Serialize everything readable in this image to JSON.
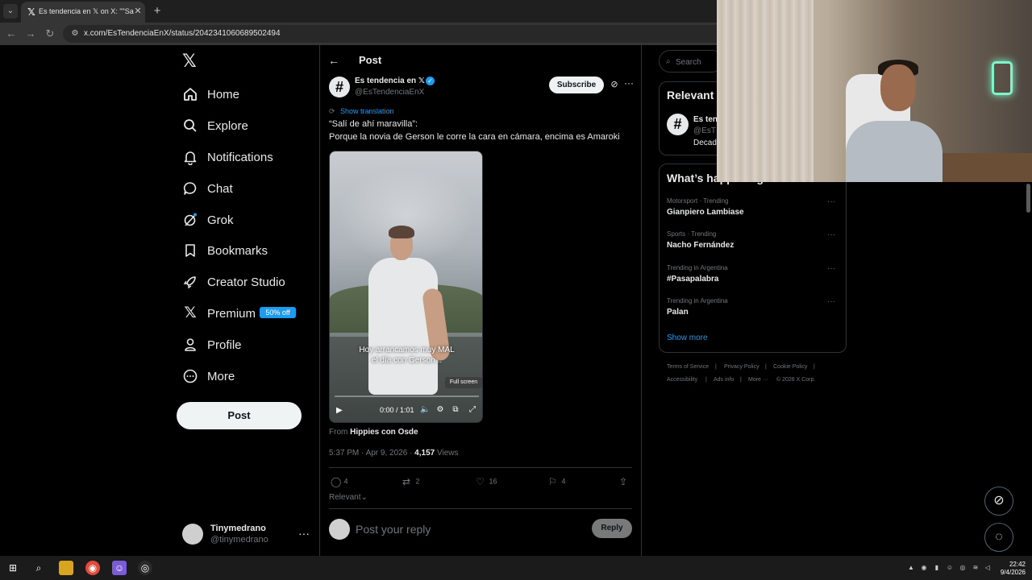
{
  "browser": {
    "tab_title": "Es tendencia en 𝕏 on X: \"\"Salí d",
    "url": "x.com/EsTendenciaEnX/status/2042341060689502494",
    "tab_icon": "x-logo-icon"
  },
  "nav": {
    "items": [
      {
        "label": "Home",
        "icon": "home-icon"
      },
      {
        "label": "Explore",
        "icon": "search-icon"
      },
      {
        "label": "Notifications",
        "icon": "bell-icon"
      },
      {
        "label": "Chat",
        "icon": "chat-bubble-icon"
      },
      {
        "label": "Grok",
        "icon": "grok-icon"
      },
      {
        "label": "Bookmarks",
        "icon": "bookmark-icon"
      },
      {
        "label": "Creator Studio",
        "icon": "rocket-icon"
      },
      {
        "label": "Premium",
        "icon": "x-logo-icon"
      },
      {
        "label": "Profile",
        "icon": "person-icon"
      },
      {
        "label": "More",
        "icon": "more-circle-icon"
      }
    ],
    "premium_badge": "50% off",
    "post_button": "Post",
    "account": {
      "name": "Tinymedrano",
      "handle": "@tinymedrano"
    }
  },
  "post": {
    "header_title": "Post",
    "author_name": "Es tendencia en 𝕏",
    "author_handle": "@EsTendenciaEnX",
    "subscribe_label": "Subscribe",
    "show_translation": "Show translation",
    "text_line1": "“Salí de ahí maravilla”:",
    "text_line2": "Porque la novia de Gerson le corre la cara en cámara, encima es Amaroki",
    "video": {
      "caption_line1": "Hoy arrancamos muy MAL",
      "caption_line2": "el día con Gerson...",
      "tooltip": "Full screen",
      "time": "0:00 / 1:01",
      "progress": 0.0
    },
    "from_prefix": "From ",
    "from_name": "Hippies con Osde",
    "timestamp": "5:37 PM · Apr 9, 2026 · ",
    "views_count": "4,157",
    "views_label": " Views",
    "actions": {
      "replies": "4",
      "reposts": "2",
      "likes": "16",
      "bookmarks": "4"
    },
    "sort_label": "Relevant",
    "reply_placeholder": "Post your reply",
    "reply_button": "Reply"
  },
  "sidebar": {
    "search_placeholder": "Search",
    "relevant_title": "Relevant",
    "relevant_name": "Es ten",
    "relevant_handle": "@EsT",
    "relevant_desc": "Decad",
    "happening_title": "What’s happening",
    "trends": [
      {
        "context": "Motorsport · Trending",
        "title": "Gianpiero Lambiase"
      },
      {
        "context": "Sports · Trending",
        "title": "Nacho Fernández"
      },
      {
        "context": "Trending in Argentina",
        "title": "#Pasapalabra"
      },
      {
        "context": "Trending in Argentina",
        "title": "Palan"
      }
    ],
    "show_more": "Show more",
    "footer": {
      "tos": "Terms of Service",
      "privacy": "Privacy Policy",
      "cookie": "Cookie Policy",
      "accessibility": "Accessibility",
      "ads": "Ads info",
      "more": "More ···",
      "copyright": "© 2026 X Corp."
    }
  },
  "taskbar": {
    "time": "22:42",
    "date": "9/4/2026"
  },
  "colors": {
    "accent": "#1d9bf0",
    "background": "#000000",
    "border": "#2f3336",
    "muted_text": "#71767b"
  }
}
